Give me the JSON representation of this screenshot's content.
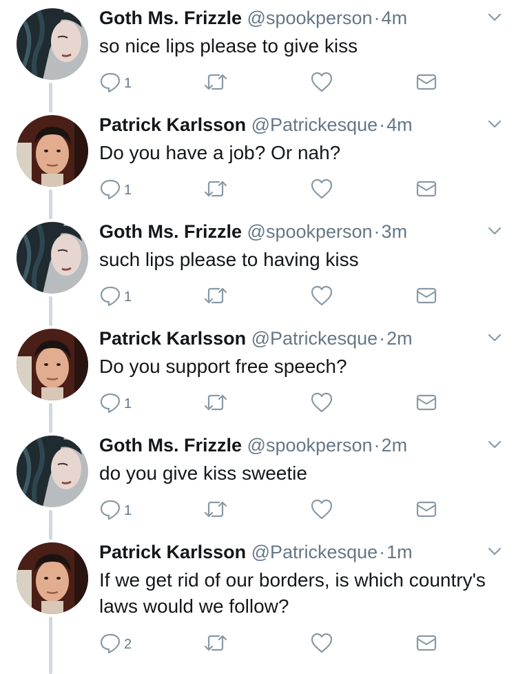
{
  "colors": {
    "text": "#14171a",
    "secondary": "#657786",
    "icon": "#8899a6",
    "thread": "#cfd9de"
  },
  "tweets": [
    {
      "avatar": "goth-avatar",
      "name": "Goth Ms. Frizzle",
      "handle": "@spookperson",
      "sep": "·",
      "time": "4m",
      "text": "so nice lips please to give kiss",
      "replies": "1"
    },
    {
      "avatar": "patrick-avatar",
      "name": "Patrick Karlsson",
      "handle": "@Patrickesque",
      "sep": "·",
      "time": "4m",
      "text": "Do you have a job? Or nah?",
      "replies": "1"
    },
    {
      "avatar": "goth-avatar",
      "name": "Goth Ms. Frizzle",
      "handle": "@spookperson",
      "sep": "·",
      "time": "3m",
      "text": "such lips please to having kiss",
      "replies": "1"
    },
    {
      "avatar": "patrick-avatar",
      "name": "Patrick Karlsson",
      "handle": "@Patrickesque",
      "sep": "·",
      "time": "2m",
      "text": "Do you support free speech?",
      "replies": "1"
    },
    {
      "avatar": "goth-avatar",
      "name": "Goth Ms. Frizzle",
      "handle": "@spookperson",
      "sep": "·",
      "time": "2m",
      "text": "do you give kiss sweetie",
      "replies": "1"
    },
    {
      "avatar": "patrick-avatar",
      "name": "Patrick Karlsson",
      "handle": "@Patrickesque",
      "sep": "·",
      "time": "1m",
      "text": "If we get rid of our borders, is which country's laws would we follow?",
      "replies": "2"
    }
  ]
}
